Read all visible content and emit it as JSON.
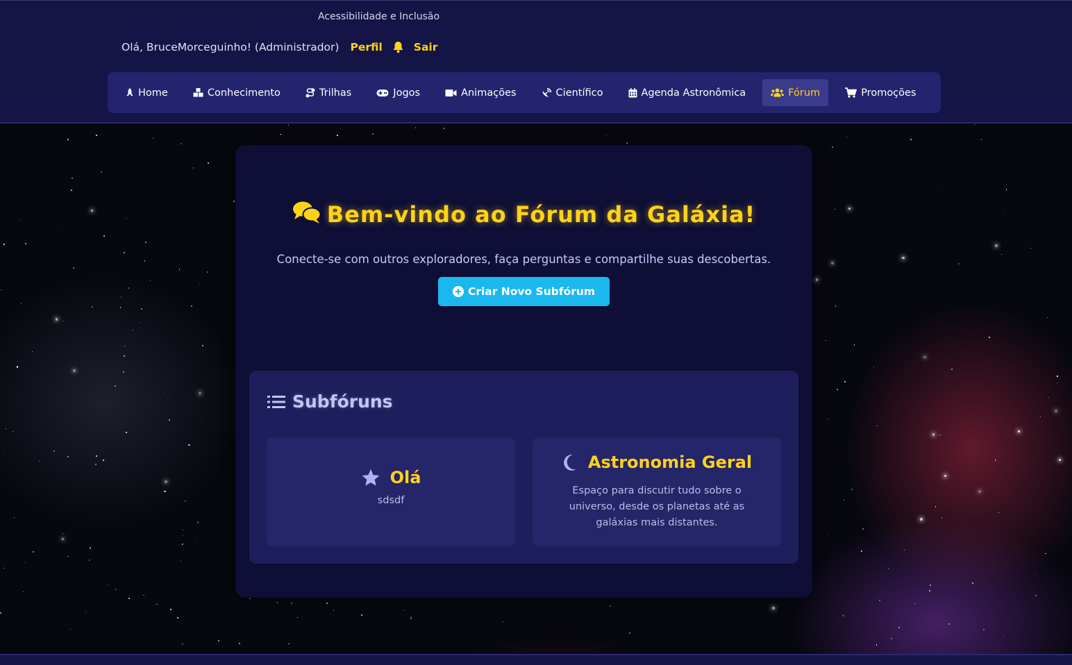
{
  "header": {
    "accessibility_link": "Acessibilidade e Inclusão",
    "greeting": "Olá, BruceMorceguinho! (Administrador)",
    "profile_link": "Perfil",
    "logout_link": "Sair",
    "accent_color": "#ffd21a"
  },
  "nav": {
    "items": [
      {
        "label": "Home",
        "icon": "rocket-icon"
      },
      {
        "label": "Conhecimento",
        "icon": "cubes-icon"
      },
      {
        "label": "Trilhas",
        "icon": "route-icon"
      },
      {
        "label": "Jogos",
        "icon": "gamepad-icon"
      },
      {
        "label": "Animações",
        "icon": "video-icon"
      },
      {
        "label": "Científico",
        "icon": "satellite-dish-icon"
      },
      {
        "label": "Agenda Astronômica",
        "icon": "calendar-icon"
      },
      {
        "label": "Fórum",
        "icon": "users-icon",
        "active": true
      },
      {
        "label": "Promoções",
        "icon": "cart-icon"
      }
    ]
  },
  "main": {
    "title": "Bem-vindo ao Fórum da Galáxia!",
    "title_icon": "comments-icon",
    "subtitle": "Conecte-se com outros exploradores, faça perguntas e compartilhe suas descobertas.",
    "create_button": "Criar Novo Subfórum",
    "button_color": "#1ab8ee"
  },
  "subforums": {
    "heading": "Subfóruns",
    "heading_icon": "list-icon",
    "items": [
      {
        "title": "Olá",
        "description": "sdsdf",
        "icon": "star-icon"
      },
      {
        "title": "Astronomia Geral",
        "description": "Espaço para discutir tudo sobre o universo, desde os planetas até as galáxias mais distantes.",
        "icon": "moon-icon"
      }
    ]
  }
}
